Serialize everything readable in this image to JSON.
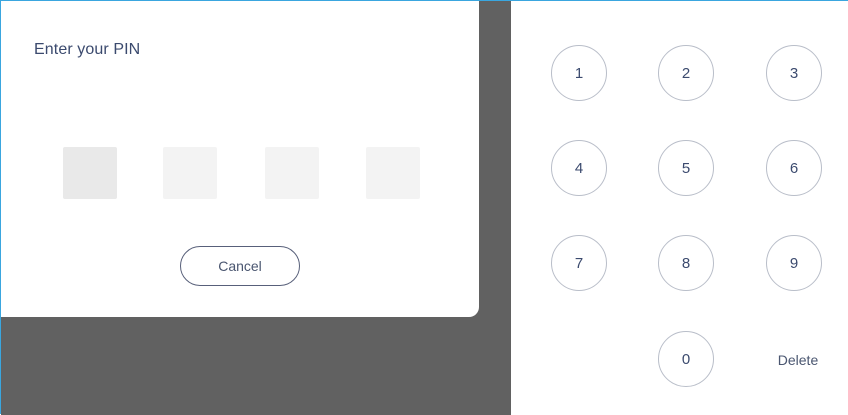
{
  "dialog": {
    "title": "Enter your PIN",
    "cancel_label": "Cancel",
    "pin_length": 4,
    "entered_digits": 0
  },
  "keypad": {
    "keys": [
      "1",
      "2",
      "3",
      "4",
      "5",
      "6",
      "7",
      "8",
      "9",
      "0"
    ],
    "delete_label": "Delete"
  },
  "colors": {
    "accent_border": "#3aa6df",
    "backdrop": "#616161",
    "text": "#3b4a6e"
  }
}
